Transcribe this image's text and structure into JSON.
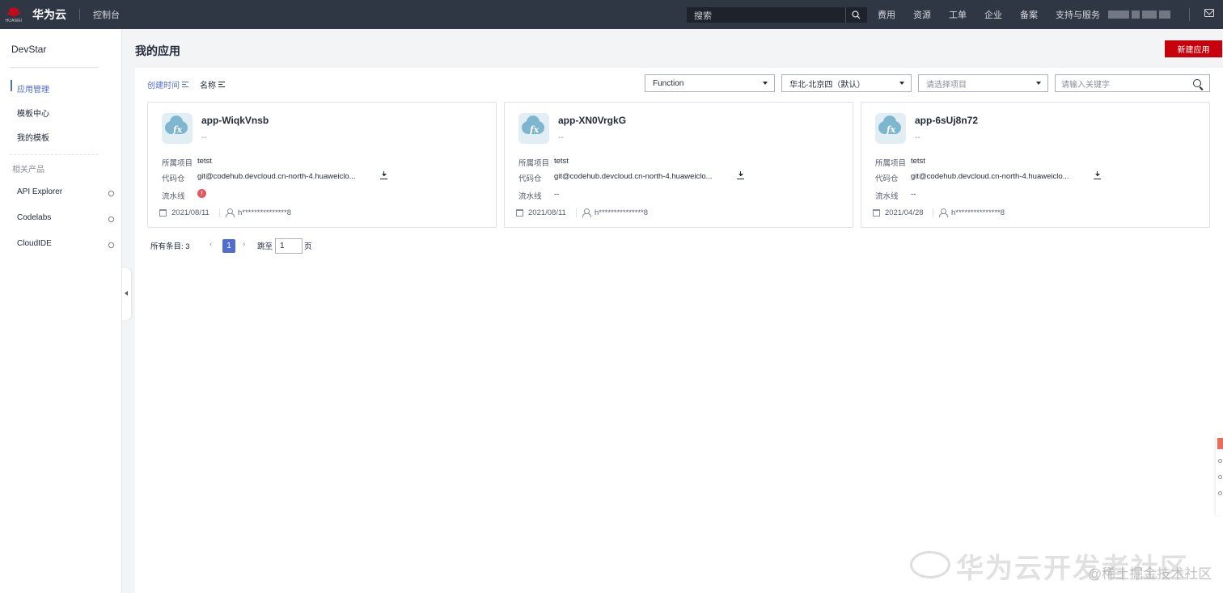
{
  "topbar": {
    "logo_sub": "HUAWEI",
    "brand": "华为云",
    "console": "控制台",
    "search_placeholder": "搜索",
    "nav": [
      "费用",
      "资源",
      "工单",
      "企业",
      "备案",
      "支持与服务"
    ]
  },
  "sidebar": {
    "title": "DevStar",
    "items": [
      {
        "label": "应用管理",
        "active": true
      },
      {
        "label": "模板中心"
      },
      {
        "label": "我的模板"
      }
    ],
    "group_label": "相关产品",
    "links": [
      {
        "label": "API Explorer"
      },
      {
        "label": "Codelabs"
      },
      {
        "label": "CloudIDE"
      }
    ]
  },
  "main": {
    "title": "我的应用",
    "new_button": "新建应用",
    "sort_created": "创建时间",
    "sort_name": "名称",
    "filter_type": "Function",
    "filter_region": "华北-北京四（默认）",
    "filter_project_placeholder": "请选择项目",
    "keyword_placeholder": "请输入关键字",
    "labels": {
      "project": "所属项目",
      "repo": "代码仓",
      "pipeline": "流水线"
    },
    "cards": [
      {
        "name": "app-WiqkVnsb",
        "desc": "--",
        "project": "tetst",
        "repo": "git@codehub.devcloud.cn-north-4.huaweiclo...",
        "pipeline": "",
        "date": "2021/08/11",
        "user": "h***************8"
      },
      {
        "name": "app-XN0VrgkG",
        "desc": "--",
        "project": "tetst",
        "repo": "git@codehub.devcloud.cn-north-4.huaweiclo...",
        "pipeline": "--",
        "date": "2021/08/11",
        "user": "h***************8"
      },
      {
        "name": "app-6sUj8n72",
        "desc": "--",
        "project": "tetst",
        "repo": "git@codehub.devcloud.cn-north-4.huaweiclo...",
        "pipeline": "--",
        "date": "2021/04/28",
        "user": "h***************8"
      }
    ],
    "pagination": {
      "total": "所有条目: 3",
      "current": "1",
      "jump_label": "跳至",
      "jump_value": "1",
      "jump_unit": "页"
    }
  },
  "watermark": {
    "main": "华为云开发者社区",
    "sub": "@稀土掘金技术社区"
  },
  "colors": {
    "topbar": "#2f3644",
    "accent": "#526ecc",
    "primary_button": "#c7000b",
    "warning": "#e6565c"
  }
}
